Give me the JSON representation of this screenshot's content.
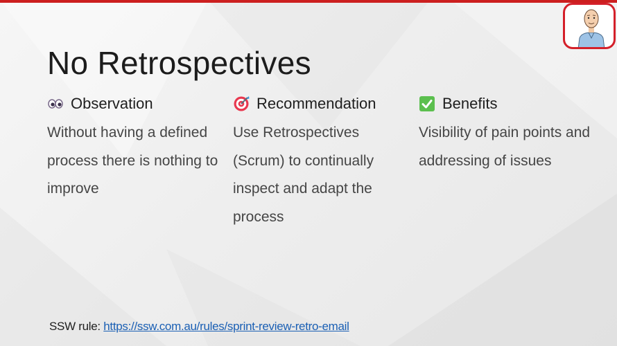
{
  "slide": {
    "title": "No Retrospectives",
    "columns": [
      {
        "heading": "Observation",
        "icon": "eyes-icon",
        "body": "Without having a defined process there is nothing to improve"
      },
      {
        "heading": "Recommendation",
        "icon": "target-icon",
        "body": "Use Retrospectives (Scrum) to continually inspect and adapt the process"
      },
      {
        "heading": "Benefits",
        "icon": "check-mark-icon",
        "body": "Visibility of pain points and addressing of issues"
      }
    ],
    "footer": {
      "prefix": "SSW rule: ",
      "link_text": "https://ssw.com.au/rules/sprint-review-retro-email"
    }
  },
  "colors": {
    "accent_red": "#cc1f1f",
    "link_blue": "#1a5fb4",
    "check_green": "#5bbf4e"
  },
  "avatar": {
    "icon": "presenter-avatar-icon"
  }
}
